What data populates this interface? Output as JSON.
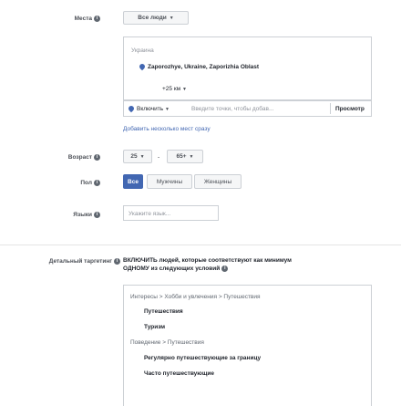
{
  "location": {
    "label": "Места",
    "audience_select": "Все люди",
    "country": "Украина",
    "place": "Zaporozhye, Ukraine, Zaporizhia Oblast",
    "radius": "+25 км",
    "include_select": "Включить",
    "search_placeholder": "Введите точки, чтобы добав...",
    "browse_button": "Просмотр",
    "add_multiple_link": "Добавить несколько мест сразу"
  },
  "age": {
    "label": "Возраст",
    "min": "25",
    "dash": "-",
    "max": "65+"
  },
  "gender": {
    "label": "Пол",
    "all": "Все",
    "male": "Мужчины",
    "female": "Женщины"
  },
  "language": {
    "label": "Языки",
    "placeholder": "Укажите язык..."
  },
  "detailed_targeting": {
    "label": "Детальный таргетинг",
    "description_line1": "ВКЛЮЧИТЬ людей, которые соответствуют как минимум",
    "description_line2": "ОДНОМУ из следующих условий",
    "groups": [
      {
        "path": "Интересы > Хобби и увлечения > Путешествия",
        "items": [
          "Путешествия",
          "Туризм"
        ]
      },
      {
        "path": "Поведение > Путешествия",
        "items": [
          "Регулярно путешествующие за границу",
          "Часто путешествующие"
        ]
      }
    ]
  },
  "icons": {
    "info": "info-icon",
    "pin": "map-pin-icon",
    "caret": "caret-down-icon"
  },
  "colors": {
    "accent": "#4267b2",
    "border": "#ccd0d5",
    "label": "#4b4f56"
  }
}
